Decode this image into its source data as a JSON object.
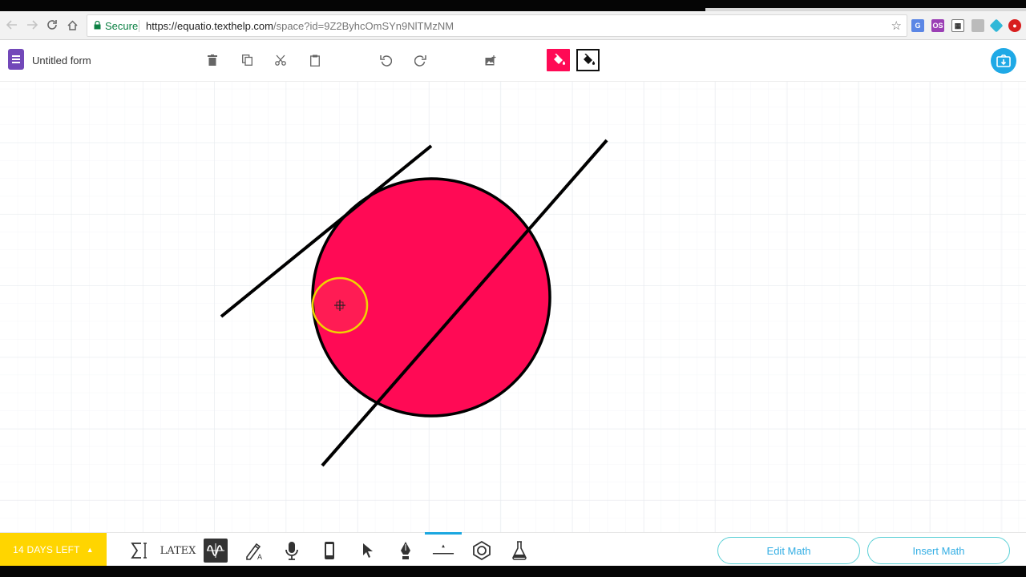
{
  "browser": {
    "secure_label": "Secure",
    "url_scheme_host": "https://equatio.texthelp.com",
    "url_path": "/space?id=9Z2ByhcOmSYn9NlTMzNM"
  },
  "app": {
    "doc_title": "Untitled form",
    "accent_color": "#ff0a55",
    "brand_color": "#1fa9e6"
  },
  "toolbar": {
    "icons": [
      "trash-icon",
      "copy-icon",
      "scissors-icon",
      "paste-icon",
      "undo-icon",
      "redo-icon",
      "insert-image-icon",
      "fill-color-icon",
      "outline-color-icon"
    ]
  },
  "canvas": {
    "shapes": [
      "circle",
      "line",
      "line"
    ],
    "circle_fill": "#ff0a55",
    "stroke_color": "#000000"
  },
  "bottom": {
    "trial_label": "14 DAYS LEFT",
    "latex_label": "LATEX",
    "edit_math_label": "Edit Math",
    "insert_math_label": "Insert Math",
    "tools": [
      "equation-editor-icon",
      "latex-icon",
      "graph-icon",
      "handwriting-icon",
      "speech-input-icon",
      "mobile-icon",
      "select-icon",
      "pen-icon",
      "line-tool-icon",
      "shape-tool-icon",
      "chemistry-icon"
    ]
  }
}
